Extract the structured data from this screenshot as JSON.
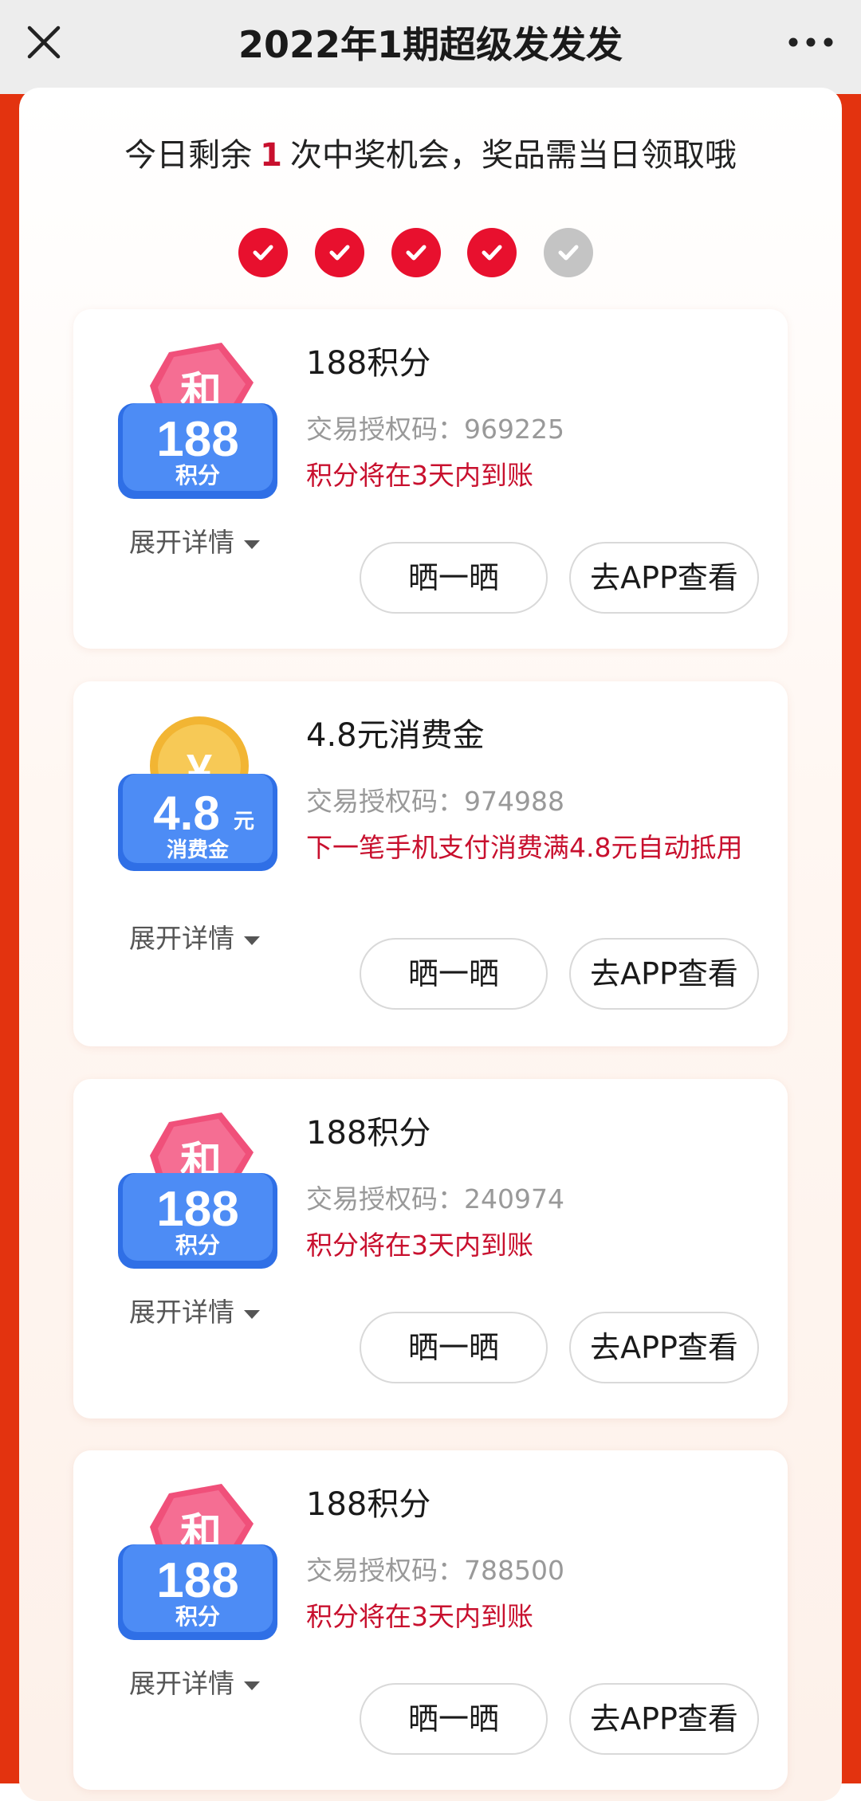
{
  "header": {
    "title": "2022年1期超级发发发",
    "close_icon": "close-icon",
    "more_icon": "more-icon"
  },
  "notice": {
    "prefix": "今日剩余",
    "count": "1",
    "suffix": "次中奖机会，奖品需当日领取哦"
  },
  "progress": {
    "total": 5,
    "completed": 4,
    "done_color": "#e8102e",
    "pending_color": "#c4c4c4"
  },
  "prizes": [
    {
      "title": "188积分",
      "badge_top": "和",
      "badge_value": "188",
      "badge_unit": "积分",
      "auth_code": "交易授权码：969225",
      "note": "积分将在3天内到账",
      "expand_label": "展开详情",
      "share_label": "晒一晒",
      "app_label": "去APP查看"
    },
    {
      "title": "4.8元消费金",
      "badge_top": "¥",
      "badge_value": "4.8",
      "badge_suffix": "元",
      "badge_unit": "消费金",
      "auth_code": "交易授权码：974988",
      "note": "下一笔手机支付消费满4.8元自动抵用",
      "expand_label": "展开详情",
      "share_label": "晒一晒",
      "app_label": "去APP查看"
    },
    {
      "title": "188积分",
      "badge_top": "和",
      "badge_value": "188",
      "badge_unit": "积分",
      "auth_code": "交易授权码：240974",
      "note": "积分将在3天内到账",
      "expand_label": "展开详情",
      "share_label": "晒一晒",
      "app_label": "去APP查看"
    },
    {
      "title": "188积分",
      "badge_top": "和",
      "badge_value": "188",
      "badge_unit": "积分",
      "auth_code": "交易授权码：788500",
      "note": "积分将在3天内到账",
      "expand_label": "展开详情",
      "share_label": "晒一晒",
      "app_label": "去APP查看"
    }
  ],
  "colors": {
    "brand_red": "#e3330f",
    "highlight_red": "#c8102e",
    "badge_blue": "#3a7df0",
    "badge_pink": "#f0507a",
    "coin_gold": "#f2b533"
  }
}
